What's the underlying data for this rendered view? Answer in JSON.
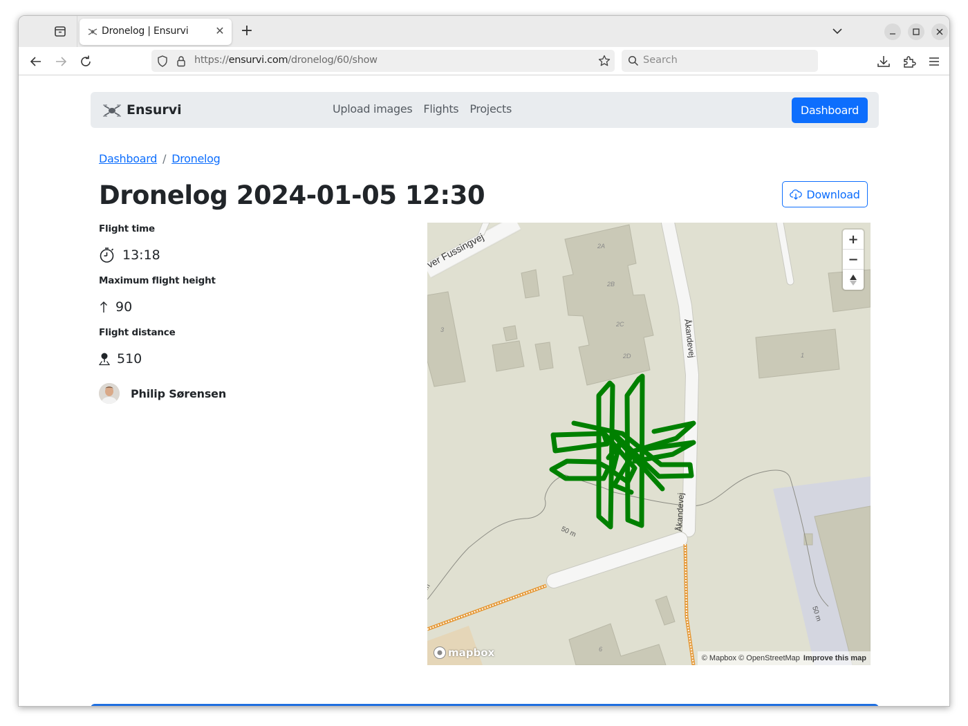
{
  "browser": {
    "tab_title": "Dronelog | Ensurvi",
    "url_scheme": "https://",
    "url_host": "ensurvi.com",
    "url_path": "/dronelog/60/show",
    "search_placeholder": "Search"
  },
  "site": {
    "brand": "Ensurvi",
    "nav_links": [
      "Upload images",
      "Flights",
      "Projects"
    ],
    "dashboard_button": "Dashboard"
  },
  "breadcrumb": {
    "items": [
      "Dashboard",
      "Dronelog"
    ],
    "separator": "/"
  },
  "page": {
    "title": "Dronelog 2024-01-05 12:30",
    "download_button": "Download"
  },
  "stats": {
    "flight_time": {
      "label": "Flight time",
      "value": "13:18",
      "icon": "stopwatch-icon"
    },
    "max_height": {
      "label": "Maximum flight height",
      "value": "90",
      "icon": "arrow-up-icon"
    },
    "distance": {
      "label": "Flight distance",
      "value": "510",
      "icon": "person-pin-icon"
    }
  },
  "user": {
    "name": "Philip Sørensen"
  },
  "map": {
    "street_labels": [
      "ver Fussingvej",
      "Åkandevej",
      "Åkandevej"
    ],
    "building_labels": [
      "2A",
      "2B",
      "2C",
      "2D",
      "3",
      "1",
      "6"
    ],
    "contour_labels": [
      "50 m",
      "50 m",
      "m"
    ],
    "zoom_in": "+",
    "zoom_out": "−",
    "logo": "mapbox",
    "attribution": "© Mapbox © OpenStreetMap",
    "improve": "Improve this map",
    "track_color": "#008000"
  }
}
